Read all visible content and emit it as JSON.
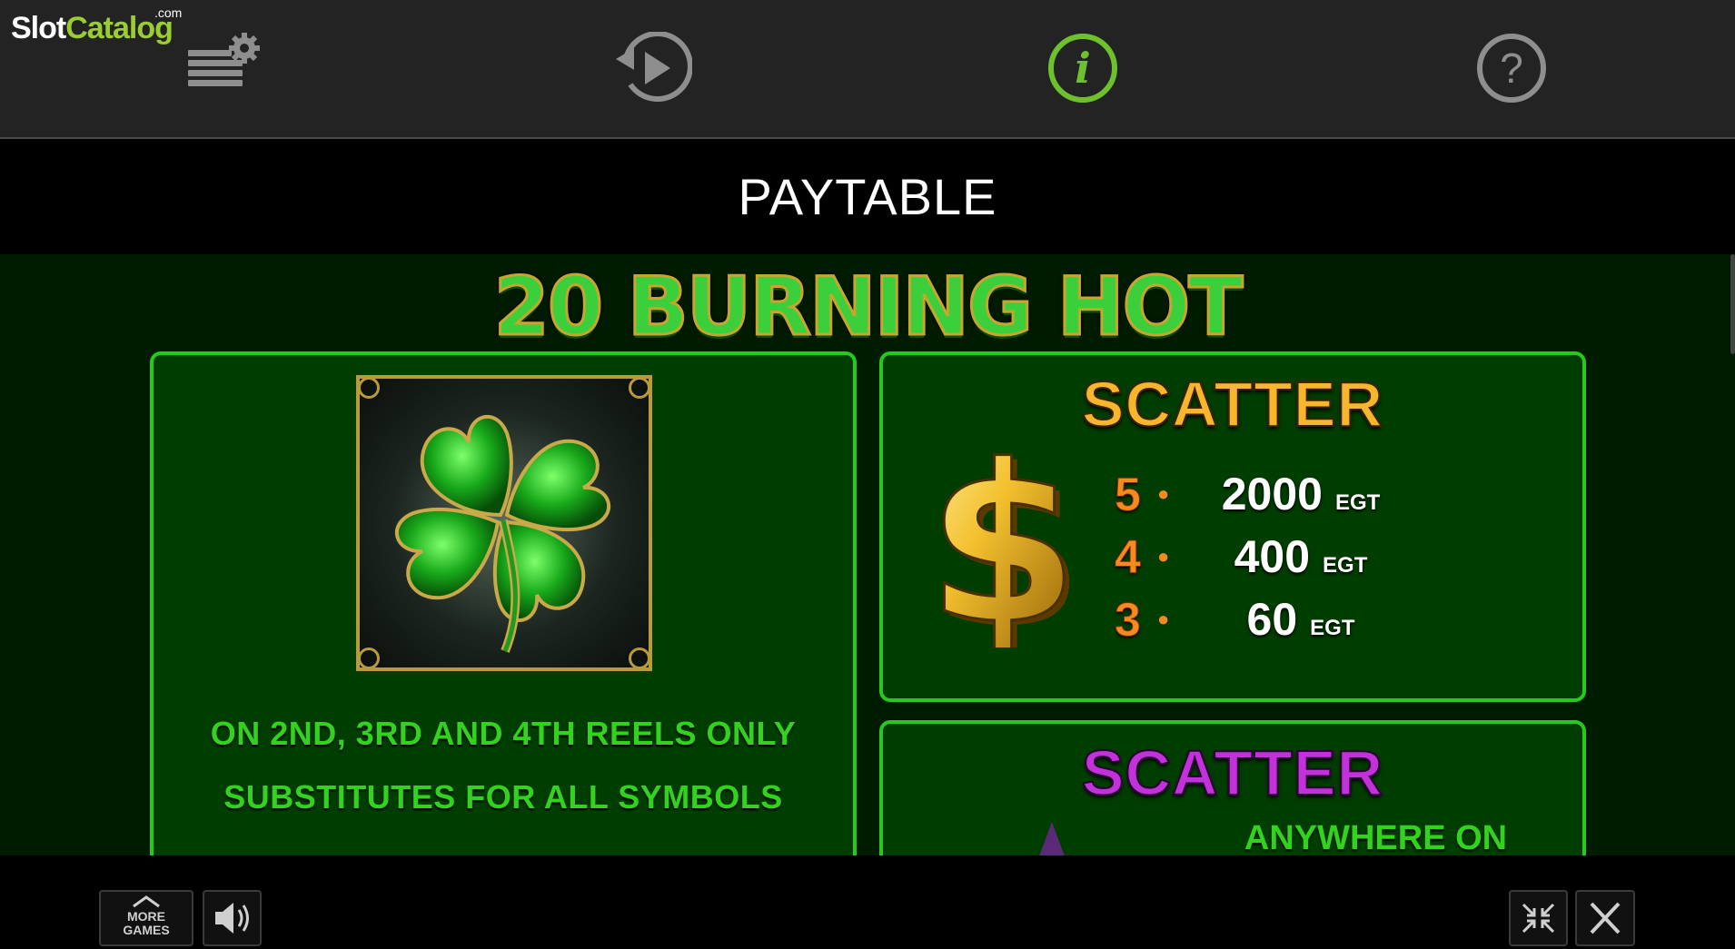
{
  "branding": {
    "logo_slot": "Slot",
    "logo_catalog": "Catalog",
    "logo_com": ".com"
  },
  "toolbar": {
    "icons": [
      "settings-icon",
      "history-replay-icon",
      "info-icon",
      "help-icon"
    ],
    "active": "info-icon",
    "active_color": "#6ec12c"
  },
  "paytable": {
    "title": "PAYTABLE"
  },
  "game": {
    "title": "20 BURNING HOT"
  },
  "wild_panel": {
    "line1": "ON 2ND, 3RD AND 4TH REELS ONLY",
    "line2": "SUBSTITUTES FOR ALL SYMBOLS",
    "symbol_icon": "four-leaf-clover-icon"
  },
  "scatter_dollar": {
    "title": "SCATTER",
    "symbol_icon": "dollar-sign-icon",
    "pays": [
      {
        "count": "5",
        "value": "2000",
        "unit": "EGT"
      },
      {
        "count": "4",
        "value": "400",
        "unit": "EGT"
      },
      {
        "count": "3",
        "value": "60",
        "unit": "EGT"
      }
    ]
  },
  "scatter_star": {
    "title": "SCATTER",
    "text": "ANYWHERE ON",
    "symbol_icon": "star-icon"
  },
  "bottombar": {
    "more_games_line1": "MORE",
    "more_games_line2": "GAMES",
    "icons": [
      "more-games-icon",
      "sound-icon",
      "minimize-icon",
      "close-icon"
    ]
  },
  "colors": {
    "panel_border": "#29c81f",
    "panel_bg": "#003d00",
    "green_text": "#33d21f",
    "gold": "#f7b62c",
    "purple": "#c133d9",
    "orange": "#f58a1f"
  }
}
